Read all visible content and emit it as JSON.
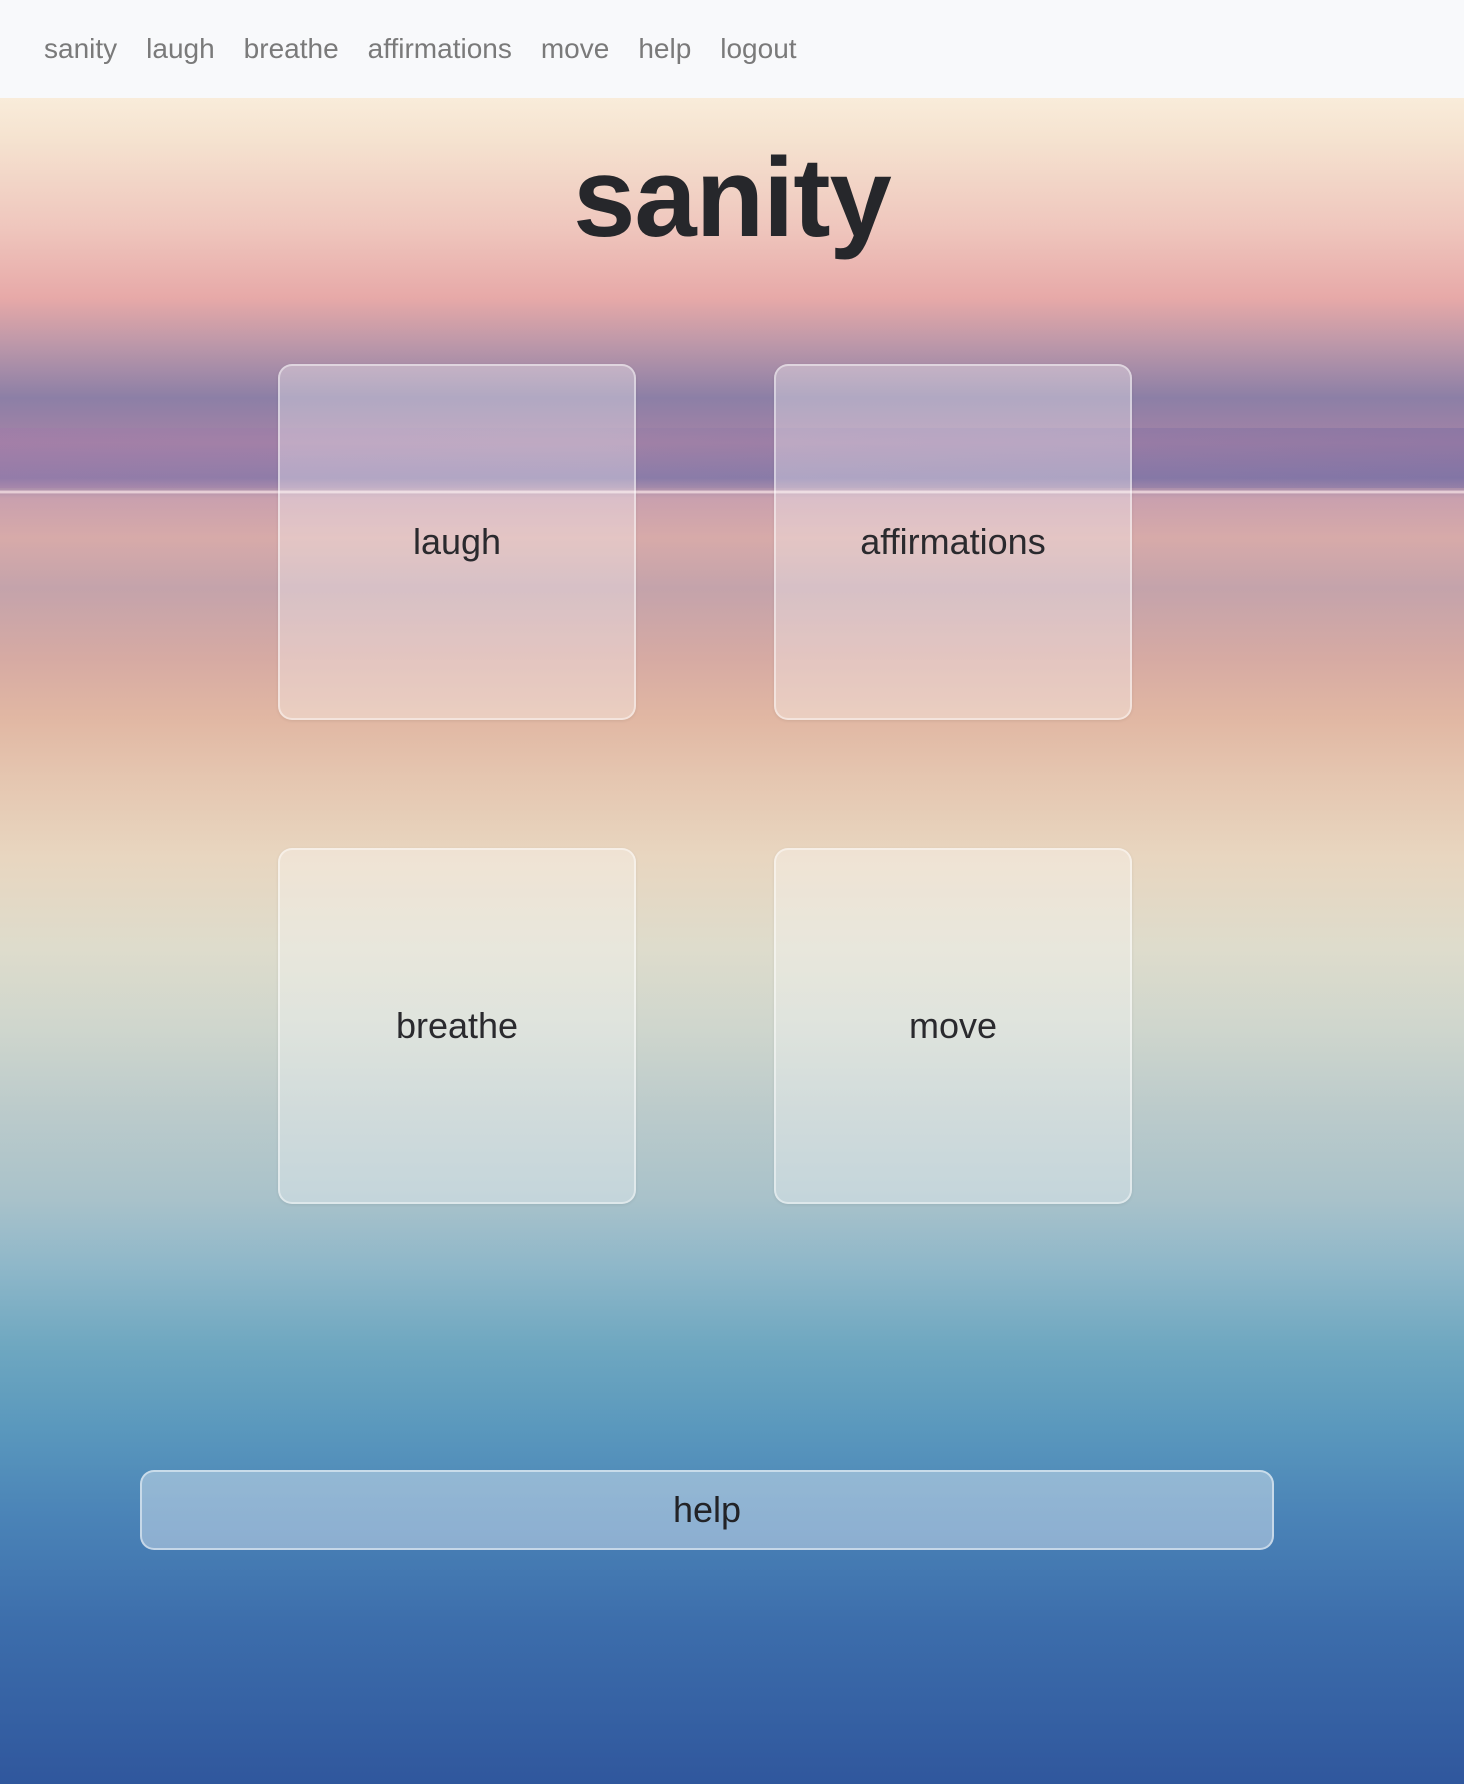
{
  "nav": {
    "items": [
      {
        "label": "sanity"
      },
      {
        "label": "laugh"
      },
      {
        "label": "breathe"
      },
      {
        "label": "affirmations"
      },
      {
        "label": "move"
      },
      {
        "label": "help"
      },
      {
        "label": "logout"
      }
    ]
  },
  "hero": {
    "title": "sanity"
  },
  "cards": [
    {
      "label": "laugh"
    },
    {
      "label": "affirmations"
    },
    {
      "label": "breathe"
    },
    {
      "label": "move"
    }
  ],
  "help_button": {
    "label": "help"
  }
}
